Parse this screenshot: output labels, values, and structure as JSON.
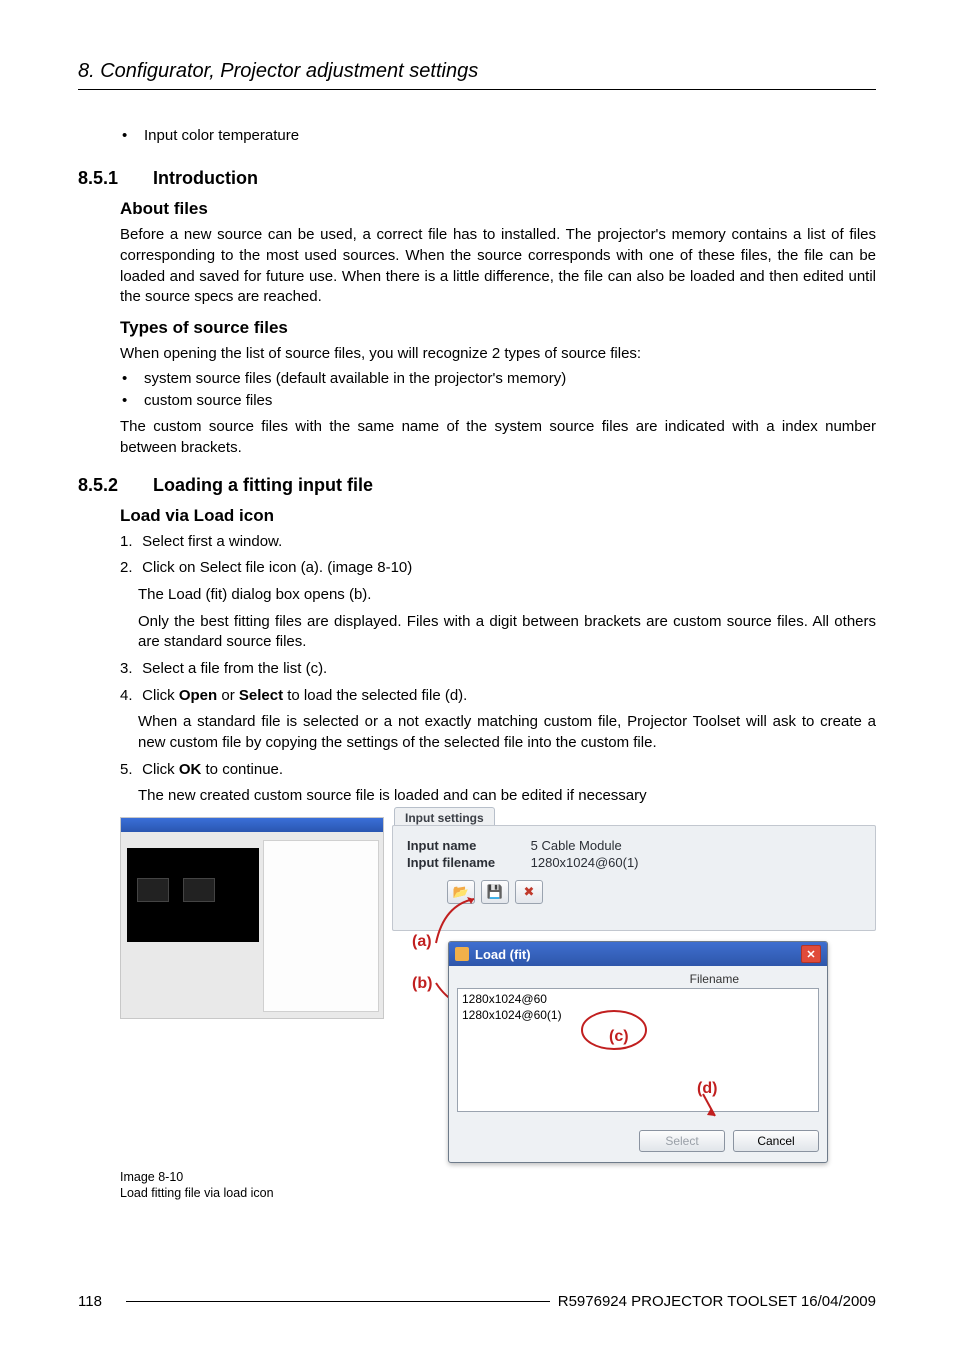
{
  "running_head": "8. Configurator, Projector adjustment settings",
  "top_bullet": "Input color temperature",
  "sec851": {
    "num": "8.5.1",
    "title": "Introduction",
    "about_head": "About files",
    "about_p": "Before a new source can be used, a correct file has to installed. The projector's memory contains a list of files corresponding to the most used sources. When the source corresponds with one of these files, the file can be loaded and saved for future use. When there is a little difference, the file can also be loaded and then edited until the source specs are reached.",
    "types_head": "Types of source files",
    "types_intro": "When opening the list of source files, you will recognize 2 types of source files:",
    "types_items": [
      "system source files (default available in the projector's memory)",
      "custom source files"
    ],
    "types_tail": "The custom source files with the same name of the system source files are indicated with a index number between brackets."
  },
  "sec852": {
    "num": "8.5.2",
    "title": "Loading a fitting input file",
    "load_head": "Load via Load icon",
    "steps": [
      {
        "n": "1.",
        "t": "Select first a window."
      },
      {
        "n": "2.",
        "t": "Click on Select file icon (a). (image 8-10)",
        "subs": [
          "The Load (fit) dialog box opens (b).",
          "Only the best fitting files are displayed. Files with a digit between brackets are custom source files. All others are standard source files."
        ]
      },
      {
        "n": "3.",
        "t": "Select a file from the list (c)."
      },
      {
        "n": "4.",
        "t_pre": "Click ",
        "b1": "Open",
        "mid": " or ",
        "b2": "Select",
        "t_post": " to load the selected file (d).",
        "subs": [
          "When a standard file is selected or a not exactly matching custom file, Projector Toolset will ask to create a new custom file by copying the settings of the selected file into the custom file."
        ]
      },
      {
        "n": "5.",
        "t_pre": "Click ",
        "b1": "OK",
        "t_post": " to continue.",
        "subs": [
          "The new created custom source file is loaded and can be edited if necessary"
        ]
      }
    ]
  },
  "figure": {
    "tab": "Input settings",
    "in_name_lbl": "Input name",
    "in_name_val": "5 Cable Module",
    "in_file_lbl": "Input filename",
    "in_file_val": "1280x1024@60(1)",
    "dialog_title": "Load (fit)",
    "col_filename": "Filename",
    "items": [
      "1280x1024@60",
      "1280x1024@60(1)"
    ],
    "btn_select": "Select",
    "btn_cancel": "Cancel",
    "anno_a": "(a)",
    "anno_b": "(b)",
    "anno_c": "(c)",
    "anno_d": "(d)",
    "caption_l1": "Image 8-10",
    "caption_l2": "Load fitting file via load icon"
  },
  "footer": {
    "page": "118",
    "right": "R5976924 PROJECTOR TOOLSET 16/04/2009"
  }
}
